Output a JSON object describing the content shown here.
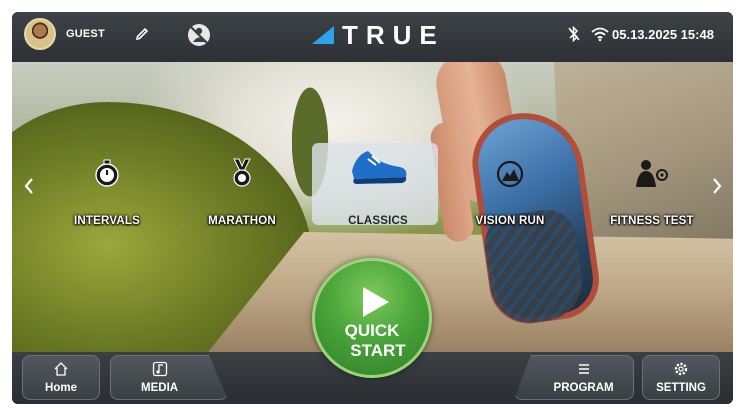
{
  "topbar": {
    "user_label": "GUEST",
    "brand": "TRUE",
    "datetime": "05.13.2025 15:48",
    "brand_color": "#2aa6e8"
  },
  "modes": [
    {
      "label": "INTERVALS",
      "icon": "stopwatch-icon"
    },
    {
      "label": "MARATHON",
      "icon": "medal-icon"
    },
    {
      "label": "CLASSICS",
      "icon": "shoe-icon",
      "selected": true
    },
    {
      "label": "VISION RUN",
      "icon": "vision-run-icon"
    },
    {
      "label": "FITNESS TEST",
      "icon": "fitness-test-icon"
    }
  ],
  "quick_start": {
    "line1": "QUICK",
    "line2": "START",
    "color": "#4aa53a"
  },
  "bottombar": {
    "home_label": "Home",
    "media_label": "MEDIA",
    "program_label": "PROGRAM",
    "setting_label": "SETTING"
  }
}
